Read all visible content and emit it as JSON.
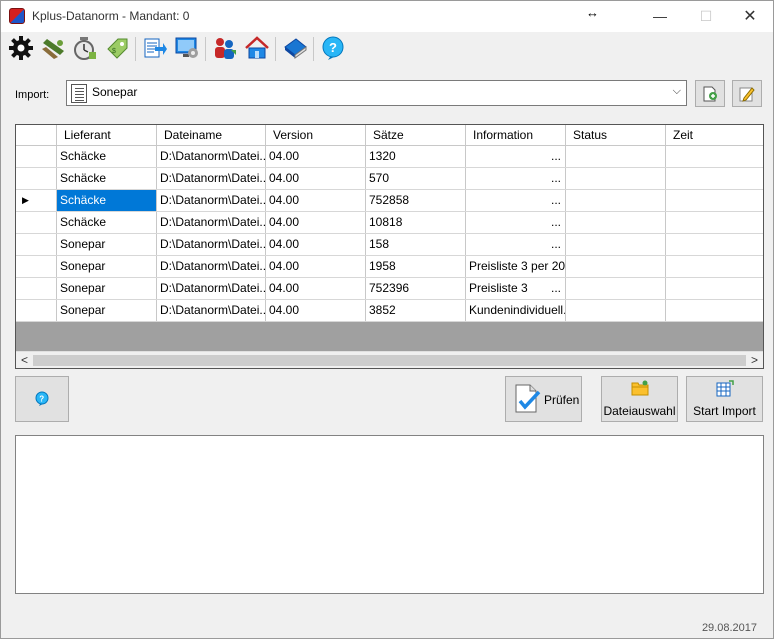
{
  "window": {
    "title": "Kplus-Datanorm - Mandant: 0",
    "controls": {
      "minimize": "—",
      "maximize": "☐",
      "close": "✕"
    },
    "cursor": "↔"
  },
  "toolbar": {
    "icons": [
      "gear-icon",
      "sawing-icon",
      "stopwatch-icon",
      "price-tag-icon",
      "export-icon",
      "monitor-settings-icon",
      "users-icon",
      "house-icon",
      "book-icon",
      "help-icon"
    ]
  },
  "import": {
    "label": "Import:",
    "selected": "Sonepar",
    "arrow": "⌵"
  },
  "grid": {
    "columns": [
      "Lieferant",
      "Dateiname",
      "Version",
      "Sätze",
      "Information",
      "Status",
      "Zeit"
    ],
    "rows": [
      {
        "lieferant": "Schäcke",
        "dateiname": "D:\\Datanorm\\Datei...",
        "version": "04.00",
        "saetze": "1320",
        "information": "...",
        "status": "",
        "zeit": ""
      },
      {
        "lieferant": "Schäcke",
        "dateiname": "D:\\Datanorm\\Datei...",
        "version": "04.00",
        "saetze": "570",
        "information": "...",
        "status": "",
        "zeit": ""
      },
      {
        "lieferant": "Schäcke",
        "dateiname": "D:\\Datanorm\\Datei...",
        "version": "04.00",
        "saetze": "752858",
        "information": "...",
        "status": "",
        "zeit": "",
        "current": true,
        "marker": "▶"
      },
      {
        "lieferant": "Schäcke",
        "dateiname": "D:\\Datanorm\\Datei...",
        "version": "04.00",
        "saetze": "10818",
        "information": "...",
        "status": "",
        "zeit": ""
      },
      {
        "lieferant": "Sonepar",
        "dateiname": "D:\\Datanorm\\Datei...",
        "version": "04.00",
        "saetze": "158",
        "information": "...",
        "status": "",
        "zeit": ""
      },
      {
        "lieferant": "Sonepar",
        "dateiname": "D:\\Datanorm\\Datei...",
        "version": "04.00",
        "saetze": "1958",
        "information": "Preisliste 3 per 20...",
        "status": "",
        "zeit": ""
      },
      {
        "lieferant": "Sonepar",
        "dateiname": "D:\\Datanorm\\Datei...",
        "version": "04.00",
        "saetze": "752396",
        "information": "Preisliste 3",
        "information_suffix": "...",
        "status": "",
        "zeit": ""
      },
      {
        "lieferant": "Sonepar",
        "dateiname": "D:\\Datanorm\\Datei...",
        "version": "04.00",
        "saetze": "3852",
        "information": "Kundenindividuell...",
        "status": "",
        "zeit": ""
      }
    ],
    "scroll": {
      "left": "<",
      "right": ">"
    }
  },
  "buttons": {
    "pruefen": "Prüfen",
    "dateiauswahl": "Dateiauswahl",
    "start_import": "Start Import"
  },
  "status": {
    "date": "29.08.2017"
  },
  "colors": {
    "selection": "#0078d7",
    "grid_background": "#a0a0a0"
  }
}
